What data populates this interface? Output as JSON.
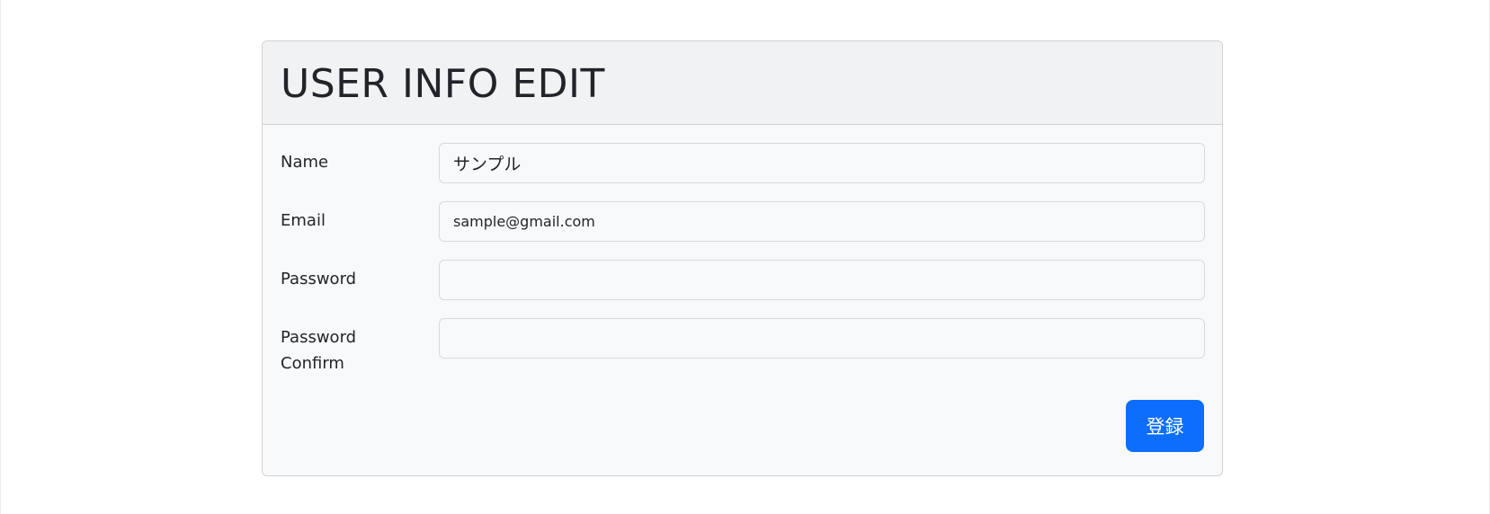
{
  "header": {
    "title": "USER INFO EDIT"
  },
  "form": {
    "name": {
      "label": "Name",
      "value": "サンプル"
    },
    "email": {
      "label": "Email",
      "value": "sample@gmail.com"
    },
    "password": {
      "label": "Password",
      "value": ""
    },
    "password_confirm": {
      "label_line1": "Password",
      "label_line2": "Confirm",
      "value": ""
    },
    "submit_label": "登録"
  },
  "colors": {
    "accent": "#0d6efd",
    "card_background": "#f8f9fa",
    "header_background": "#f1f2f3"
  }
}
